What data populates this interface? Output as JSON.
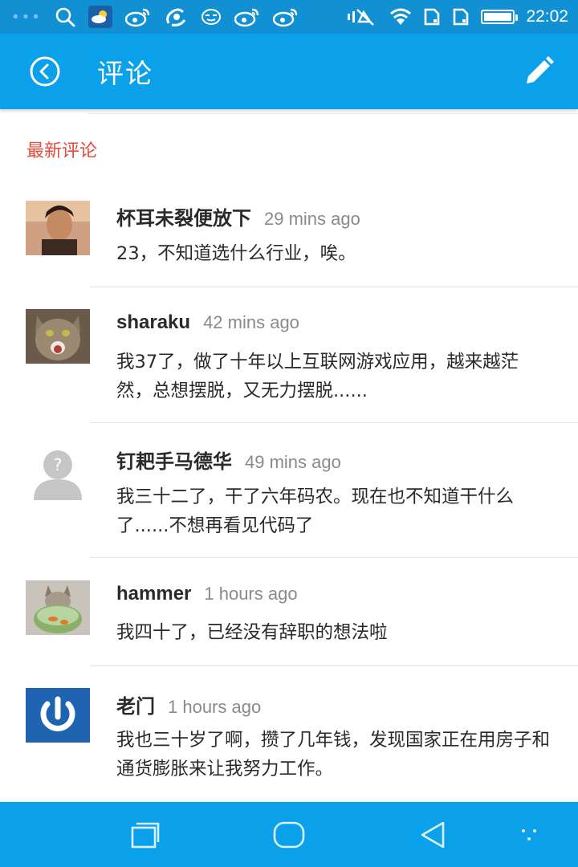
{
  "status_bar": {
    "time": "22:02",
    "icons": [
      "signal-dots-icon",
      "search-icon",
      "weather-icon",
      "weibo-icon",
      "qq-icon",
      "mask-icon",
      "weibo-icon",
      "weibo-icon",
      "mute-icon",
      "wifi-icon",
      "sim-icon",
      "sim-icon",
      "battery-icon"
    ],
    "battery_level": 1.0
  },
  "app_bar": {
    "title": "评论",
    "back_icon": "back-circle-icon",
    "edit_icon": "pencil-icon",
    "background": "#0aa0ea"
  },
  "section": {
    "label": "最新评论",
    "color": "#e64a3b"
  },
  "comments": [
    {
      "name": "杯耳未裂便放下",
      "time": "29 mins ago",
      "body": "23，不知道选什么行业，唉。"
    },
    {
      "name": "sharaku",
      "time": "42 mins ago",
      "body": "我37了，做了十年以上互联网游戏应用，越来越茫然，总想摆脱，又无力摆脱......"
    },
    {
      "name": "钉耙手马德华",
      "time": "49 mins ago",
      "body": "我三十二了，干了六年码农。现在也不知道干什么了......不想再看见代码了"
    },
    {
      "name": "hammer",
      "time": "1 hours ago",
      "body": "我四十了，已经没有辞职的想法啦"
    },
    {
      "name": "老门",
      "time": "1 hours ago",
      "body": "我也三十岁了啊，攒了几年钱，发现国家正在用房子和通货膨胀来让我努力工作。"
    }
  ],
  "nav_bar": {
    "icons": [
      "recent-apps-icon",
      "home-icon",
      "back-triangle-icon",
      "menu-dots-icon"
    ]
  }
}
